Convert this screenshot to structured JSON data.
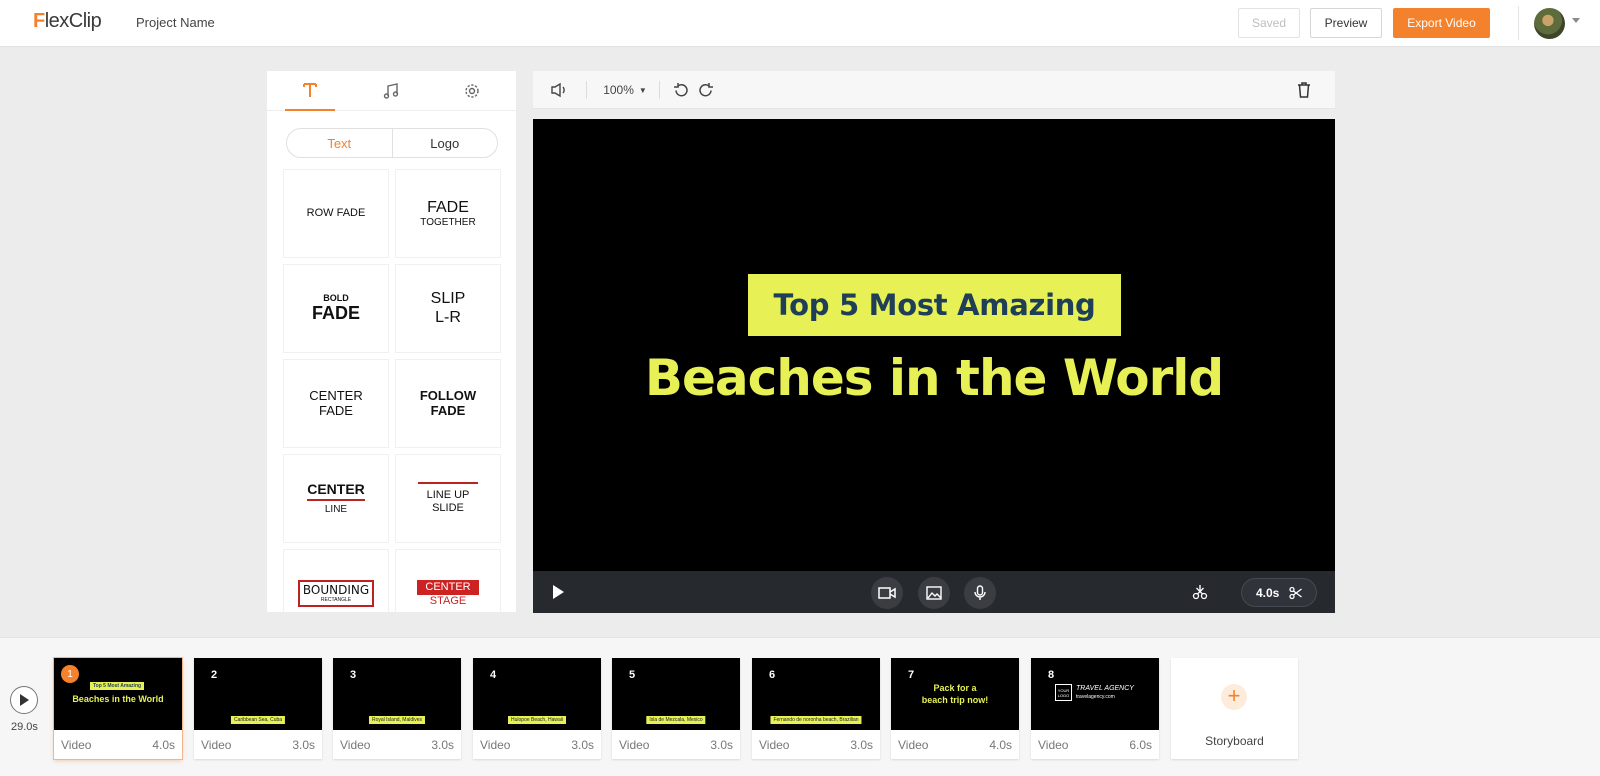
{
  "header": {
    "logo": "FlexClip",
    "project_name": "Project Name",
    "saved_label": "Saved",
    "preview_label": "Preview",
    "export_label": "Export Video",
    "accent_color": "#f4822c"
  },
  "left_panel": {
    "tabs": [
      "text-icon",
      "music-icon",
      "settings-icon"
    ],
    "segments": {
      "text": "Text",
      "logo": "Logo"
    },
    "templates": [
      {
        "line1": "ROW FADE",
        "line2": ""
      },
      {
        "line1": "FADE",
        "line2": "TOGETHER"
      },
      {
        "line1": "BOLD",
        "line2": "FADE"
      },
      {
        "line1": "SLIP",
        "line2": "L-R"
      },
      {
        "line1": "CENTER",
        "line2": "FADE"
      },
      {
        "line1": "FOLLOW",
        "line2": "FADE"
      },
      {
        "line1": "CENTER",
        "line2": "LINE"
      },
      {
        "line1": "LINE UP",
        "line2": "SLIDE"
      },
      {
        "line1": "BOUNDING",
        "line2": "RECTANGLE"
      },
      {
        "line1": "CENTER",
        "line2": "STAGE"
      }
    ]
  },
  "preview": {
    "zoom": "100%",
    "title_small": "Top 5 Most Amazing",
    "title_big": "Beaches in the World",
    "title_color": "#e7f155",
    "clip_duration": "4.0s"
  },
  "timeline": {
    "total_duration": "29.0s",
    "clips": [
      {
        "num": "1",
        "type": "Video",
        "duration": "4.0s",
        "thumb_line1": "Top 5 Most Amazing",
        "thumb_line2": "Beaches in the World"
      },
      {
        "num": "2",
        "type": "Video",
        "duration": "3.0s",
        "tag": "Caribbean Sea, Cuba"
      },
      {
        "num": "3",
        "type": "Video",
        "duration": "3.0s",
        "tag": "Royal Island, Maldives"
      },
      {
        "num": "4",
        "type": "Video",
        "duration": "3.0s",
        "tag": "Hulopoe Beach, Hawaii"
      },
      {
        "num": "5",
        "type": "Video",
        "duration": "3.0s",
        "tag": "Isla de Mezcala, Mexico"
      },
      {
        "num": "6",
        "type": "Video",
        "duration": "3.0s",
        "tag": "Fernando de noronha beach, Brazilian"
      },
      {
        "num": "7",
        "type": "Video",
        "duration": "4.0s",
        "thumb_line1": "Pack for a",
        "thumb_line2": "beach trip now!"
      },
      {
        "num": "8",
        "type": "Video",
        "duration": "6.0s",
        "logo_box": "YOUR LOGO",
        "thumb_line1": "TRAVEL AGENCY",
        "thumb_line2": "travelagency.com"
      }
    ],
    "storyboard_label": "Storyboard"
  }
}
